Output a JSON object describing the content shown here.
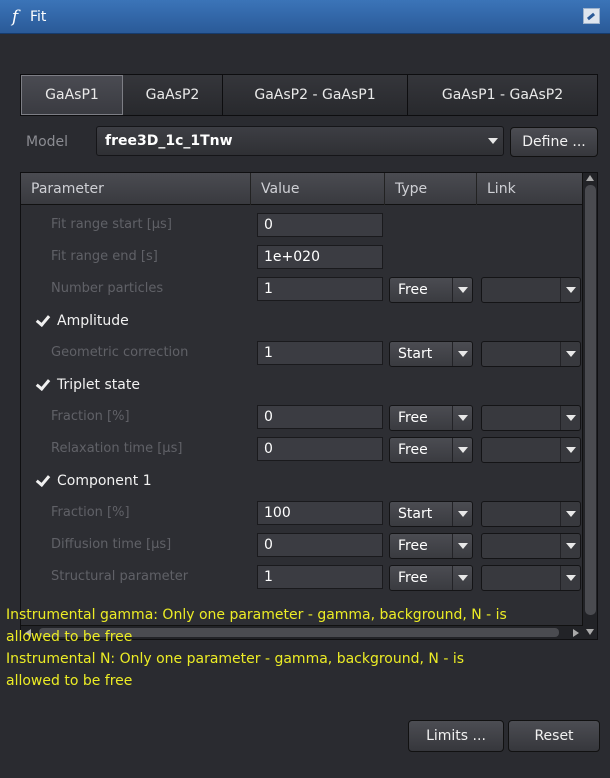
{
  "window": {
    "title": "Fit",
    "icon": "function-icon"
  },
  "tabs": [
    {
      "label": "GaAsP1",
      "active": true
    },
    {
      "label": "GaAsP2",
      "active": false
    },
    {
      "label": "GaAsP2 - GaAsP1",
      "active": false
    },
    {
      "label": "GaAsP1 - GaAsP2",
      "active": false
    }
  ],
  "model": {
    "label": "Model",
    "value": "free3D_1c_1Tnw",
    "define_label": "Define ..."
  },
  "table": {
    "headers": [
      "Parameter",
      "Value",
      "Type",
      "Link"
    ],
    "rows": [
      {
        "kind": "param",
        "name": "Fit range start [µs]",
        "value": "0"
      },
      {
        "kind": "param",
        "name": "Fit range end [s]",
        "value": "1e+020"
      },
      {
        "kind": "param",
        "name": "Number particles",
        "value": "1",
        "type": "Free"
      },
      {
        "kind": "group",
        "name": "Amplitude",
        "checked": true
      },
      {
        "kind": "param",
        "name": "Geometric correction",
        "value": "1",
        "type": "Start"
      },
      {
        "kind": "group",
        "name": "Triplet state",
        "checked": true
      },
      {
        "kind": "param",
        "name": "Fraction [%]",
        "value": "0",
        "type": "Free"
      },
      {
        "kind": "param",
        "name": "Relaxation time [µs]",
        "value": "0",
        "type": "Free"
      },
      {
        "kind": "group",
        "name": "Component 1",
        "checked": true
      },
      {
        "kind": "param",
        "name": "Fraction [%]",
        "value": "100",
        "type": "Start"
      },
      {
        "kind": "param",
        "name": "Diffusion time [µs]",
        "value": "0",
        "type": "Free"
      },
      {
        "kind": "param",
        "name": "Structural parameter",
        "value": "1",
        "type": "Free"
      }
    ]
  },
  "messages": {
    "line1": "Instrumental gamma: Only one parameter - gamma, background, N - is",
    "line2": "allowed to be free",
    "line3": "Instrumental N: Only one parameter - gamma, background, N - is",
    "line4": "allowed to be free"
  },
  "buttons": {
    "limits": "Limits ...",
    "reset": "Reset"
  },
  "colors": {
    "title_bar": "#2f63a6",
    "warning_text": "#ecec25",
    "panel_bg": "#2a2b30"
  }
}
